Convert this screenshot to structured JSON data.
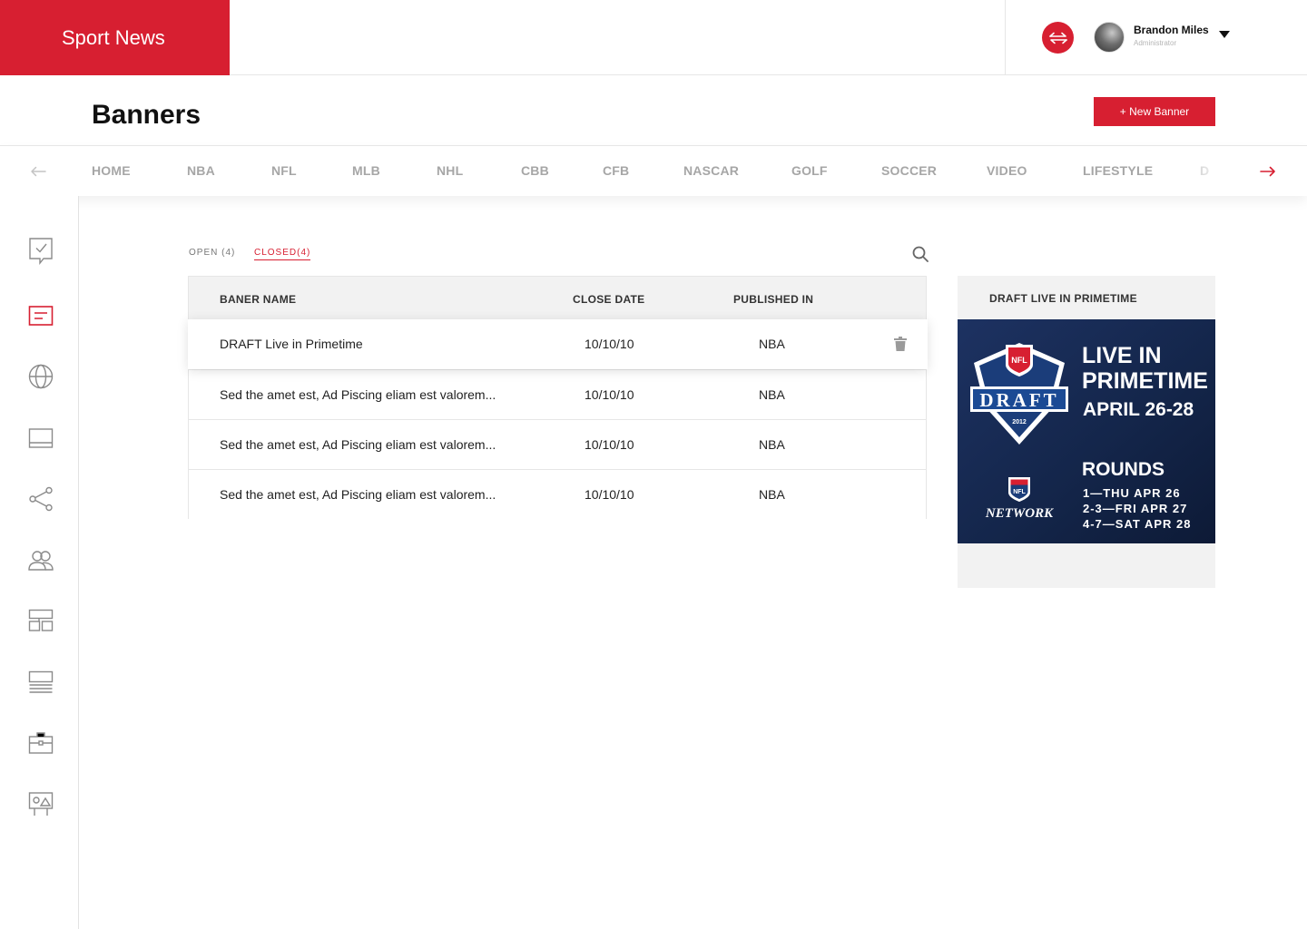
{
  "app": {
    "brand": "Sport News"
  },
  "user": {
    "name": "Brandon Miles",
    "role": "Administrator"
  },
  "page": {
    "title": "Banners",
    "new_button": "+ New Banner"
  },
  "nav": {
    "categories": [
      "HOME",
      "NBA",
      "NFL",
      "MLB",
      "NHL",
      "CBB",
      "CFB",
      "NASCAR",
      "GOLF",
      "SOCCER",
      "VIDEO",
      "LIFESTYLE",
      "D"
    ]
  },
  "tabs": {
    "open": "OPEN (4)",
    "closed": "CLOSED(4)"
  },
  "table": {
    "headers": {
      "name": "BANER NAME",
      "date": "CLOSE DATE",
      "published": "PUBLISHED IN"
    },
    "rows": [
      {
        "name": "DRAFT Live in Primetime",
        "date": "10/10/10",
        "published": "NBA"
      },
      {
        "name": "Sed the amet est, Ad Piscing eliam est valorem...",
        "date": "10/10/10",
        "published": "NBA"
      },
      {
        "name": "Sed the amet est, Ad Piscing eliam est valorem...",
        "date": "10/10/10",
        "published": "NBA"
      },
      {
        "name": "Sed the amet est, Ad Piscing eliam est valorem...",
        "date": "10/10/10",
        "published": "NBA"
      }
    ]
  },
  "preview": {
    "title": "DRAFT LIVE IN PRIMETIME",
    "banner": {
      "logo_top": "NFL",
      "logo_word": "DRAFT",
      "logo_year": "2012",
      "network_logo": "NFL",
      "network_word": "NETWORK",
      "headline_1": "LIVE IN",
      "headline_2": "PRIMETIME",
      "dates": "APRIL 26-28",
      "rounds_title": "ROUNDS",
      "rounds": [
        "1—THU APR 26",
        "2-3—FRI APR 27",
        "4-7—SAT APR 28"
      ]
    }
  },
  "colors": {
    "accent": "#d71f31",
    "muted": "#a6a6a6",
    "header_bg": "#f2f2f2",
    "banner_bg": "#13244a"
  },
  "icons": {
    "sidebar": [
      "task-check-icon",
      "banner-icon",
      "globe-icon",
      "layout-icon",
      "share-icon",
      "users-icon",
      "blocks-icon",
      "list-icon",
      "briefcase-icon",
      "media-board-icon"
    ]
  }
}
